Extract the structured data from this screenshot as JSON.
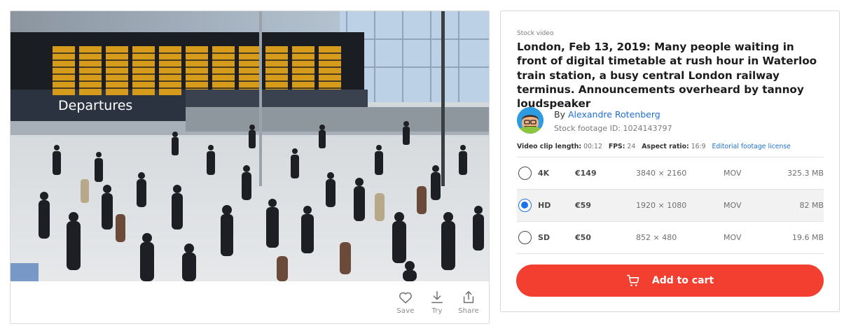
{
  "preview": {
    "sign_text": "Departures",
    "actions": [
      {
        "label": "Save",
        "icon": "heart-icon"
      },
      {
        "label": "Try",
        "icon": "download-icon"
      },
      {
        "label": "Share",
        "icon": "share-icon"
      }
    ]
  },
  "detail": {
    "kicker": "Stock video",
    "title": "London, Feb 13, 2019: Many people waiting in front of digital timetable at rush hour in Waterloo train station, a busy central London railway terminus. Announcements overheard by tannoy loudspeaker",
    "author_prefix": "By",
    "author_name": "Alexandre Rotenberg",
    "footage_id": "Stock footage ID: 1024143797",
    "meta": {
      "length_label": "Video clip length:",
      "length_value": "00:12",
      "fps_label": "FPS:",
      "fps_value": "24",
      "aspect_label": "Aspect ratio:",
      "aspect_value": "16:9",
      "license": "Editorial footage license"
    },
    "options": [
      {
        "res": "4K",
        "price": "€149",
        "dims": "3840 × 2160",
        "format": "MOV",
        "size": "325.3 MB",
        "selected": false
      },
      {
        "res": "HD",
        "price": "€59",
        "dims": "1920 × 1080",
        "format": "MOV",
        "size": "82 MB",
        "selected": true
      },
      {
        "res": "SD",
        "price": "€50",
        "dims": "852 × 480",
        "format": "MOV",
        "size": "19.6 MB",
        "selected": false
      }
    ],
    "cart_label": "Add to cart"
  },
  "colors": {
    "accent_red": "#f23f2f",
    "link_blue": "#1e6fd0",
    "radio_blue": "#1a73e8"
  }
}
